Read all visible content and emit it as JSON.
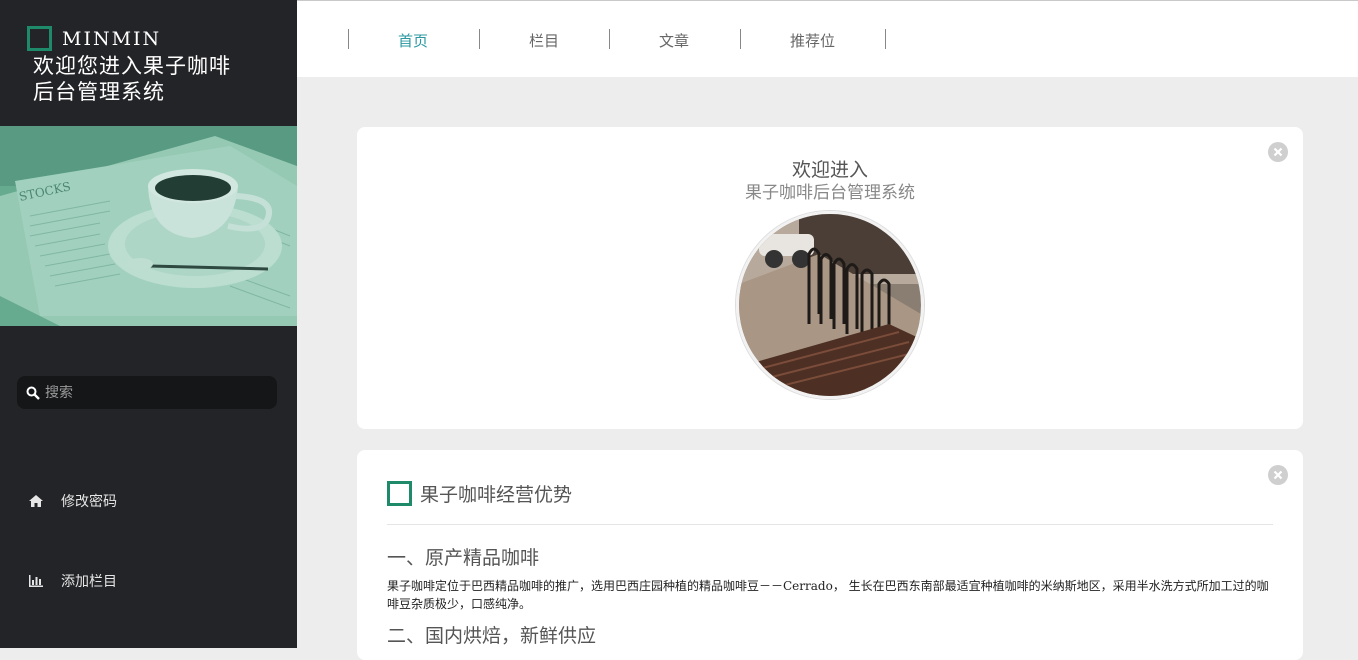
{
  "brand": {
    "name": "MINMIN",
    "title_line1": "欢迎您进入果子咖啡",
    "title_line2": "后台管理系统"
  },
  "search": {
    "placeholder": "搜索"
  },
  "menu": [
    {
      "label": "修改密码",
      "icon": "home-icon"
    },
    {
      "label": "添加栏目",
      "icon": "bar-chart-icon"
    }
  ],
  "nav": {
    "items": [
      {
        "label": "首页",
        "active": true
      },
      {
        "label": "栏目",
        "active": false
      },
      {
        "label": "文章",
        "active": false
      },
      {
        "label": "推荐位",
        "active": false
      }
    ]
  },
  "welcome": {
    "title": "欢迎进入",
    "subtitle": "果子咖啡后台管理系统"
  },
  "advantages": {
    "title": "果子咖啡经营优势",
    "section1_title": "一、原产精品咖啡",
    "section1_body": "果子咖啡定位于巴西精品咖啡的推广，选用巴西庄园种植的精品咖啡豆－－Cerrado， 生长在巴西东南部最适宜种植咖啡的米纳斯地区，采用半水洗方式所加工过的咖啡豆杂质极少，口感纯净。",
    "section2_title": "二、国内烘焙，新鲜供应"
  },
  "colors": {
    "sidebar_bg": "#232427",
    "accent_green": "#1f8a6a",
    "nav_active": "#2a98a0",
    "page_bg": "#ededed"
  }
}
